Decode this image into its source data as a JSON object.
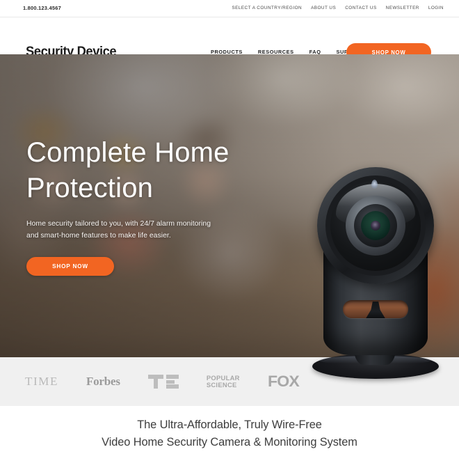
{
  "topbar": {
    "phone": "1.800.123.4567",
    "links": [
      {
        "label": "SELECT A COUNTRY/REGION"
      },
      {
        "label": "ABOUT US"
      },
      {
        "label": "CONTACT US"
      },
      {
        "label": "NEWSLETTER"
      },
      {
        "label": "LOGIN"
      }
    ]
  },
  "header": {
    "logo": "Security Device",
    "nav": [
      {
        "label": "PRODUCTS"
      },
      {
        "label": "RESOURCES"
      },
      {
        "label": "FAQ"
      },
      {
        "label": "SUPPORT"
      }
    ],
    "shop_button": "SHOP NOW"
  },
  "hero": {
    "title": "Complete Home\nProtection",
    "subtitle": "Home security tailored to you, with 24/7 alarm monitoring\nand smart-home features to make life easier.",
    "cta": "SHOP NOW",
    "product_alt": "security-camera"
  },
  "press": {
    "logos": [
      {
        "name": "TIME",
        "label": "TIME"
      },
      {
        "name": "Forbes",
        "label": "Forbes"
      },
      {
        "name": "TechCrunch",
        "label": "TC"
      },
      {
        "name": "Popular Science",
        "label": "POPULAR\nSCIENCE"
      },
      {
        "name": "FOX",
        "label": "FOX"
      }
    ]
  },
  "tagline": {
    "text": "The Ultra-Affordable, Truly Wire-Free\nVideo Home Security Camera & Monitoring System"
  },
  "colors": {
    "accent_orange": "#f26522",
    "press_band": "#f0f0f0",
    "text_dark": "#1c1c1c",
    "tagline_text": "#3d3d3d"
  }
}
